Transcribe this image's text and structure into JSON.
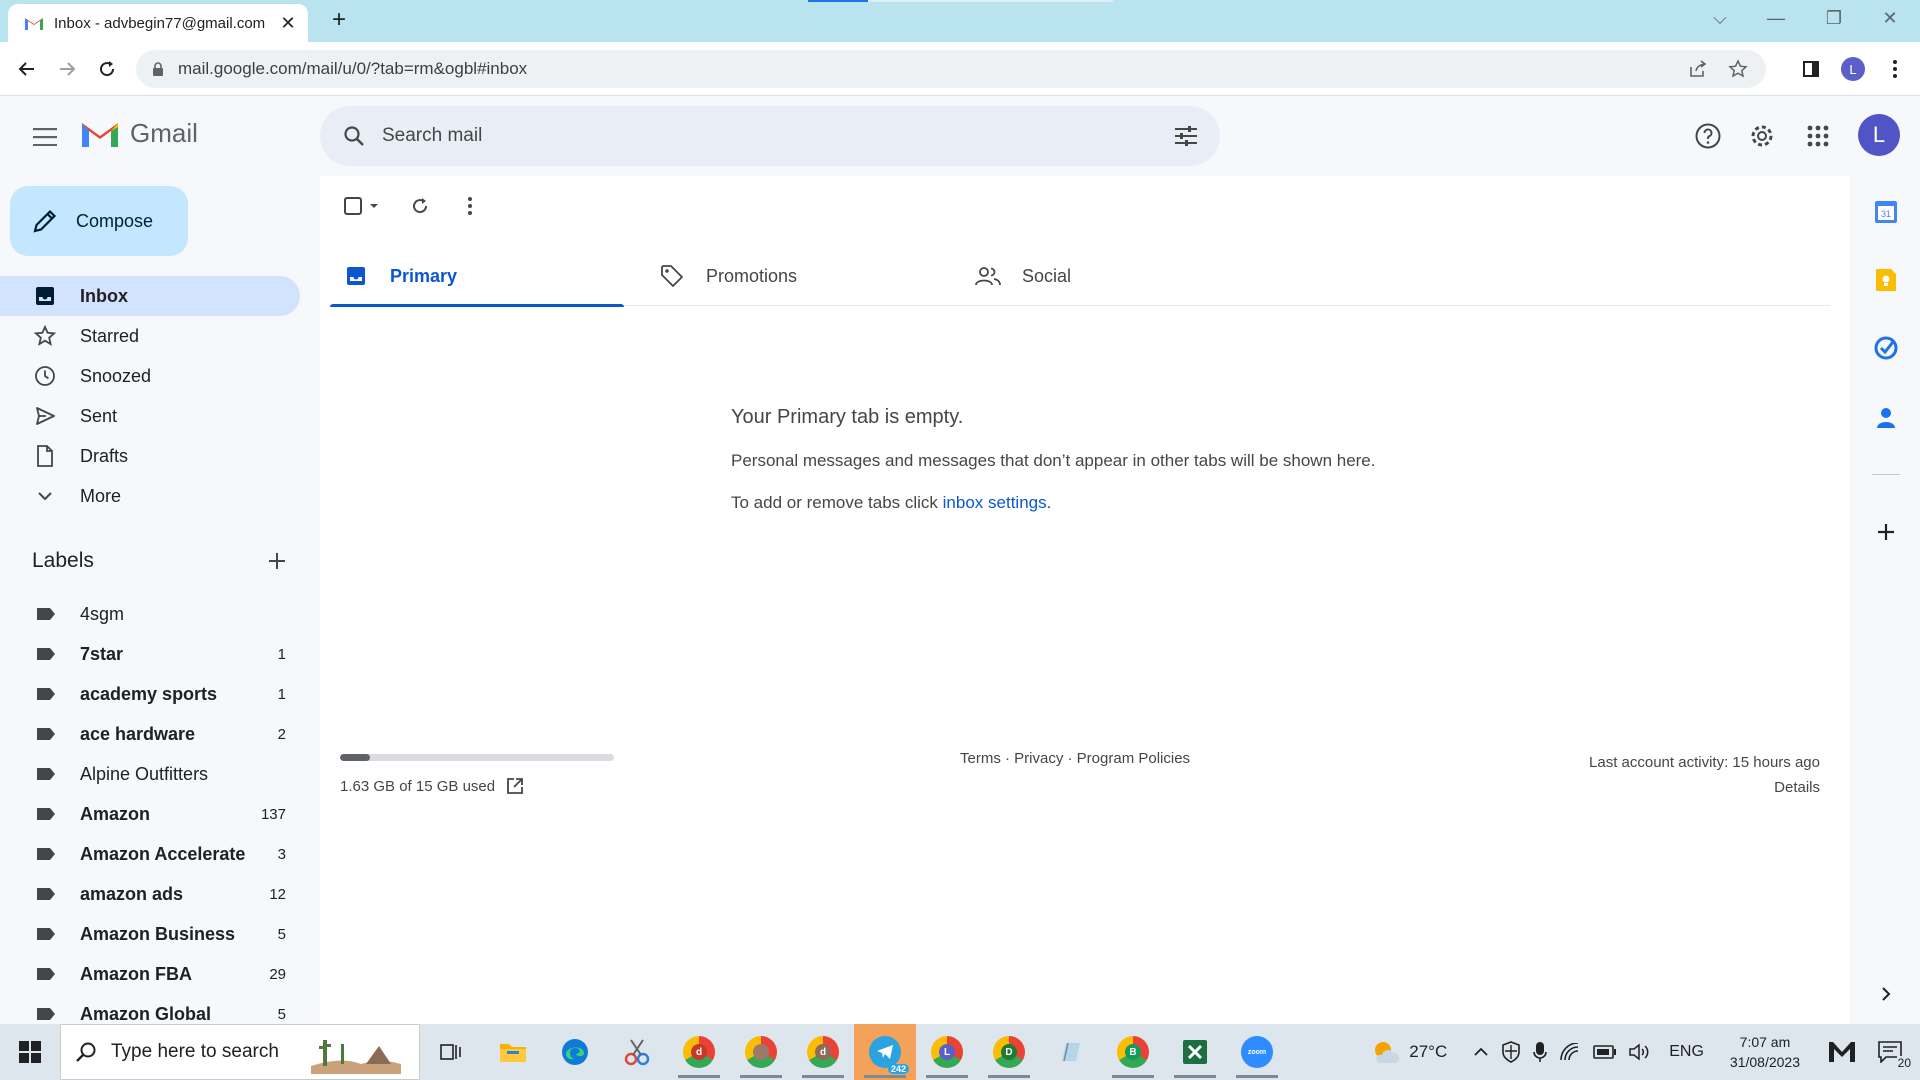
{
  "browser": {
    "tab_title": "Inbox - advbegin77@gmail.com",
    "url": "mail.google.com/mail/u/0/?tab=rm&ogbl#inbox",
    "profile_initial": "L"
  },
  "gmail": {
    "logo_text": "Gmail",
    "search_placeholder": "Search mail",
    "avatar_initial": "L",
    "compose_label": "Compose",
    "nav": [
      {
        "label": "Inbox",
        "icon": "inbox-icon"
      },
      {
        "label": "Starred",
        "icon": "star-icon"
      },
      {
        "label": "Snoozed",
        "icon": "clock-icon"
      },
      {
        "label": "Sent",
        "icon": "send-icon"
      },
      {
        "label": "Drafts",
        "icon": "draft-icon"
      },
      {
        "label": "More",
        "icon": "chevron-down-icon"
      }
    ],
    "labels_heading": "Labels",
    "labels": [
      {
        "name": "4sgm",
        "count": ""
      },
      {
        "name": "7star",
        "count": "1"
      },
      {
        "name": "academy sports",
        "count": "1"
      },
      {
        "name": "ace hardware",
        "count": "2"
      },
      {
        "name": "Alpine Outfitters",
        "count": ""
      },
      {
        "name": "Amazon",
        "count": "137"
      },
      {
        "name": "Amazon Accelerate",
        "count": "3"
      },
      {
        "name": "amazon ads",
        "count": "12"
      },
      {
        "name": "Amazon Business",
        "count": "5"
      },
      {
        "name": "Amazon FBA",
        "count": "29"
      },
      {
        "name": "Amazon Global",
        "count": "5"
      }
    ],
    "tabs": [
      {
        "label": "Primary",
        "icon": "inbox-tab-icon"
      },
      {
        "label": "Promotions",
        "icon": "tag-icon"
      },
      {
        "label": "Social",
        "icon": "people-icon"
      }
    ],
    "empty_state": {
      "heading": "Your Primary tab is empty.",
      "line1": "Personal messages and messages that don’t appear in other tabs will be shown here.",
      "line2_prefix": "To add or remove tabs click ",
      "line2_link": "inbox settings",
      "line2_suffix": "."
    },
    "footer": {
      "storage_text": "1.63 GB of 15 GB used",
      "storage_fraction": 0.109,
      "links": "Terms · Privacy · Program Policies",
      "last_activity": "Last account activity: 15 hours ago",
      "details": "Details"
    }
  },
  "taskbar": {
    "search_placeholder": "Type here to search",
    "telegram_badge": "242",
    "chrome_letters": [
      "d",
      "",
      "d",
      "L",
      "D",
      "B"
    ],
    "zoom_label": "zoom",
    "weather": "27°C",
    "lang": "ENG",
    "time": "7:07 am",
    "date": "31/08/2023",
    "notifications": "20"
  },
  "colors": {
    "accent": "#0b57d0",
    "compose_bg": "#c2e7ff",
    "active_nav": "#d3e3fd",
    "bg": "#f6f8fc"
  }
}
